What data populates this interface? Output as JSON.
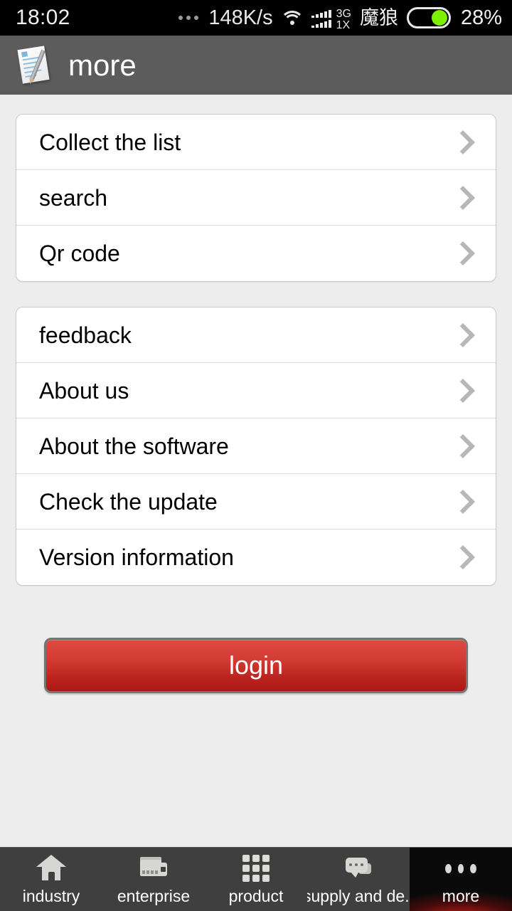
{
  "status_bar": {
    "clock": "18:02",
    "overflow_dots": "...",
    "net_speed": "148K/s",
    "wifi_icon": "wifi-icon",
    "signal_icon": "signal-bars-icon",
    "network_type_top": "3G",
    "network_type_bottom": "1X",
    "carrier": "魔狼",
    "battery_icon": "battery-icon",
    "battery_percent": "28%",
    "battery_fill_color": "#7bf000",
    "background_color": "#000000"
  },
  "title_bar": {
    "icon": "document-pencil-icon",
    "title": "more",
    "background_color": "#5c5c5c",
    "text_color": "#ffffff"
  },
  "content": {
    "background_color": "#ededed",
    "groups": [
      {
        "id": "group-1",
        "items": [
          {
            "label": "Collect the list",
            "chevron": "chevron-right-icon"
          },
          {
            "label": "search",
            "chevron": "chevron-right-icon"
          },
          {
            "label": "Qr code",
            "chevron": "chevron-right-icon"
          }
        ]
      },
      {
        "id": "group-2",
        "items": [
          {
            "label": "feedback",
            "chevron": "chevron-right-icon"
          },
          {
            "label": "About us",
            "chevron": "chevron-right-icon"
          },
          {
            "label": "About the software",
            "chevron": "chevron-right-icon"
          },
          {
            "label": "Check the update",
            "chevron": "chevron-right-icon"
          },
          {
            "label": "Version information",
            "chevron": "chevron-right-icon"
          }
        ]
      }
    ],
    "login_button": {
      "label": "login",
      "color_top": "#de4a42",
      "color_bottom": "#ab1712",
      "text_color": "#ffffff",
      "border_color": "#747474"
    }
  },
  "bottom_nav": {
    "background_color": "#3f3f3f",
    "active_glow_color": "#dc1e1a",
    "items": [
      {
        "label": "industry",
        "icon": "home-icon",
        "active": false
      },
      {
        "label": "enterprise",
        "icon": "factory-icon",
        "active": false
      },
      {
        "label": "product",
        "icon": "grid-icon",
        "active": false
      },
      {
        "label": "supply and de..",
        "icon": "chat-bubbles-icon",
        "active": false
      },
      {
        "label": "more",
        "icon": "ellipsis-icon",
        "active": true
      }
    ]
  }
}
